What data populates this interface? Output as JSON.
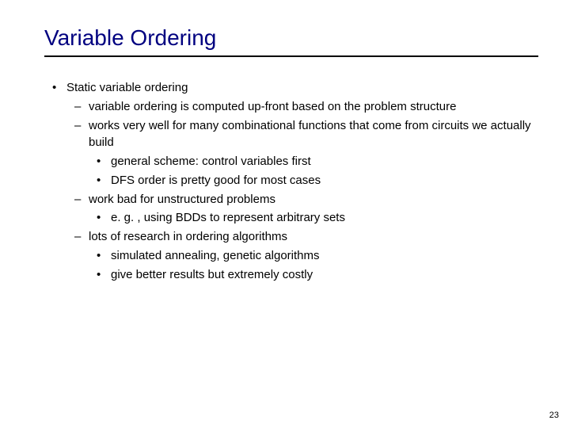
{
  "title": "Variable Ordering",
  "page_number": "23",
  "bullets": {
    "l1_0": "Static variable ordering",
    "l2_0": "variable ordering is computed up-front based on the problem structure",
    "l2_1": "works very well for many combinational functions that come from circuits we actually build",
    "l3_0": "general scheme: control variables first",
    "l3_1": "DFS order is pretty good for most cases",
    "l2_2": "work bad for unstructured problems",
    "l3_2": "e. g. , using BDDs to represent arbitrary sets",
    "l2_3": "lots of research in ordering algorithms",
    "l3_3": "simulated annealing, genetic algorithms",
    "l3_4": "give better results but extremely costly"
  }
}
